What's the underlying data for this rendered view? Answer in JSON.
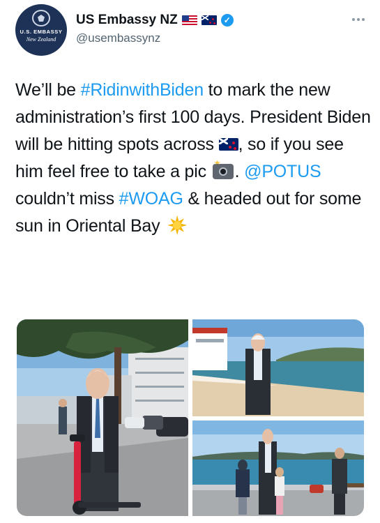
{
  "account": {
    "display_name": "US Embassy NZ",
    "handle": "@usembassynz",
    "avatar_line1": "U.S. EMBASSY",
    "avatar_line2": "New Zealand",
    "verified": true
  },
  "tweet": {
    "part1": "We’ll be ",
    "hashtag1": "#RidinwithBiden",
    "part2": " to mark the new administration’s first 100 days. President Biden will be hitting spots across ",
    "part3": ", so if you see him feel free to take a pic ",
    "part4": ". ",
    "mention1": "@POTUS",
    "part5": " couldn’t miss ",
    "hashtag2": "#WOAG",
    "part6": " & headed out for some sun in Oriental Bay "
  },
  "icons": {
    "flag_us": "us-flag-icon",
    "flag_nz": "nz-flag-icon",
    "verified": "verified-badge-icon",
    "more": "more-options-icon",
    "camera": "camera-flash-emoji",
    "sun": "sun-emoji"
  },
  "colors": {
    "link": "#1d9bf0",
    "text": "#0f1419",
    "secondary": "#536471",
    "avatar_bg": "#1d3256"
  },
  "media": {
    "count": 3
  }
}
